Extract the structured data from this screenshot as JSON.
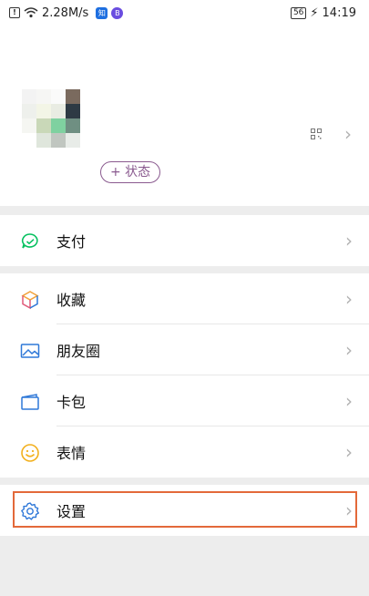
{
  "status_bar": {
    "speed": "2.28M/s",
    "app_badge_1": "知",
    "app_badge_2": "B",
    "battery": "56",
    "time": "14:19"
  },
  "profile": {
    "status_button": "+ 状态"
  },
  "menu": {
    "pay": "支付",
    "favorites": "收藏",
    "moments": "朋友圈",
    "cards": "卡包",
    "stickers": "表情",
    "settings": "设置"
  },
  "colors": {
    "accent_green": "#07c160",
    "highlight_border": "#e3693a",
    "icon_blue": "#2f78d8"
  }
}
